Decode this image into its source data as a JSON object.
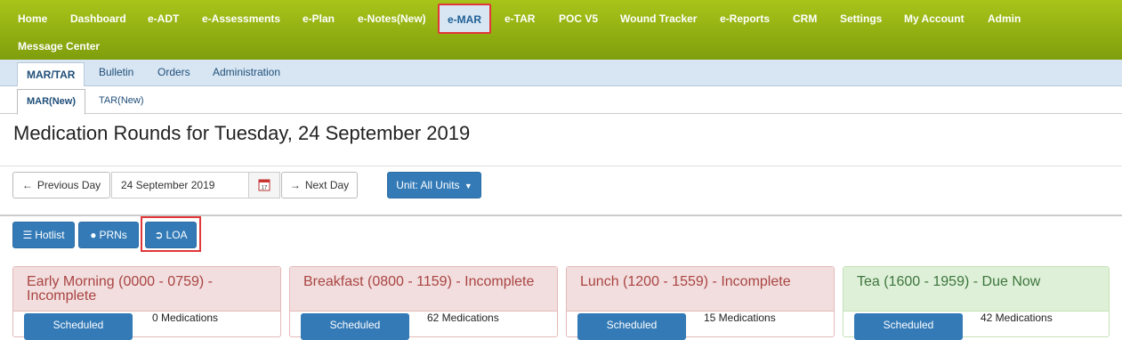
{
  "top_nav": [
    {
      "label": "Home"
    },
    {
      "label": "Dashboard"
    },
    {
      "label": "e-ADT"
    },
    {
      "label": "e-Assessments"
    },
    {
      "label": "e-Plan"
    },
    {
      "label": "e-Notes(New)"
    },
    {
      "label": "e-MAR"
    },
    {
      "label": "e-TAR"
    },
    {
      "label": "POC V5"
    },
    {
      "label": "Wound Tracker"
    },
    {
      "label": "e-Reports"
    },
    {
      "label": "CRM"
    },
    {
      "label": "Settings"
    },
    {
      "label": "My Account"
    },
    {
      "label": "Admin"
    },
    {
      "label": "Message Center"
    }
  ],
  "sub_nav": [
    "MAR/TAR",
    "Bulletin",
    "Orders",
    "Administration"
  ],
  "sub_nav2": [
    "MAR(New)",
    "TAR(New)"
  ],
  "page_title": "Medication Rounds for Tuesday, 24 September 2019",
  "toolbar": {
    "prev_label": "Previous Day",
    "date_value": "24 September 2019",
    "next_label": "Next Day",
    "unit_label": "Unit: All Units"
  },
  "actions": {
    "hotlist": "Hotlist",
    "prns": "PRNs",
    "loa": "LOA"
  },
  "rounds": [
    {
      "title": "Early Morning (0000 - 0759) - Incomplete",
      "button": "Scheduled",
      "count": "0 Medications",
      "status": "incomplete"
    },
    {
      "title": "Breakfast (0800 - 1159) - Incomplete",
      "button": "Scheduled",
      "count": "62 Medications",
      "status": "incomplete"
    },
    {
      "title": "Lunch (1200 - 1559) - Incomplete",
      "button": "Scheduled",
      "count": "15 Medications",
      "status": "incomplete"
    },
    {
      "title": "Tea (1600 - 1959) - Due Now",
      "button": "Scheduled",
      "count": "42 Medications",
      "status": "due"
    }
  ],
  "colors": {
    "nav_green": "#8fb112",
    "accent_blue": "#337ab7",
    "incomplete_bg": "#f2dede",
    "due_bg": "#dff0d8",
    "highlight_red": "#e0373a"
  }
}
